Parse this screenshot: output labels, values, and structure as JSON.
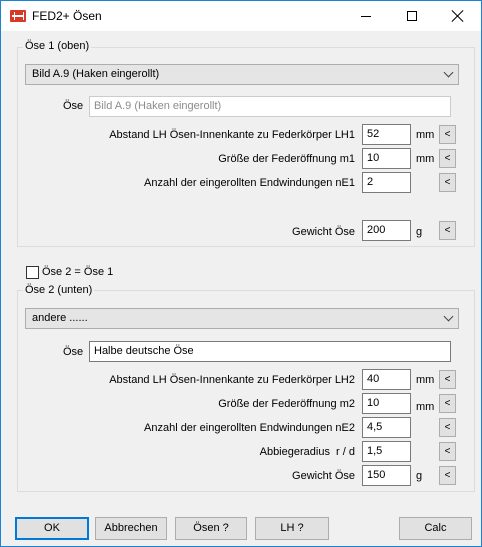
{
  "window": {
    "title": "FED2+ Ösen"
  },
  "group1": {
    "label": "Öse 1 (oben)",
    "combo_value": "Bild A.9 (Haken eingerollt)",
    "oese_label": "Öse",
    "oese_value": "Bild A.9 (Haken eingerollt)",
    "rows": [
      {
        "label": "Abstand LH Ösen-Innenkante zu Federkörper LH1",
        "value": "52",
        "unit": "mm"
      },
      {
        "label": "Größe der Federöffnung m1",
        "value": "10",
        "unit": "mm"
      },
      {
        "label": "Anzahl der eingerollten Endwindungen nE1",
        "value": "2",
        "unit": ""
      }
    ],
    "weight": {
      "label": "Gewicht Öse",
      "value": "200",
      "unit": "g"
    }
  },
  "same_checkbox": {
    "label": "Öse 2 = Öse 1",
    "checked": false
  },
  "group2": {
    "label": "Öse 2 (unten)",
    "combo_value": "andere ......",
    "oese_label": "Öse",
    "oese_value": "Halbe deutsche Öse",
    "rows": [
      {
        "label": "Abstand LH Ösen-Innenkante zu Federkörper LH2",
        "value": "40",
        "unit": "mm"
      },
      {
        "label": "Größe der Federöffnung m2",
        "value": "10",
        "unit": "mm"
      },
      {
        "label": "Anzahl der eingerollten Endwindungen nE2",
        "value": "4,5",
        "unit": ""
      },
      {
        "label": "Abbiegeradius  r / d",
        "value": "1,5",
        "unit": ""
      },
      {
        "label": "Gewicht Öse",
        "value": "150",
        "unit": "g"
      }
    ]
  },
  "side_button_label": "<",
  "buttons": {
    "ok": "OK",
    "cancel": "Abbrechen",
    "oesen": "Ösen ?",
    "lh": "LH ?",
    "calc": "Calc"
  }
}
